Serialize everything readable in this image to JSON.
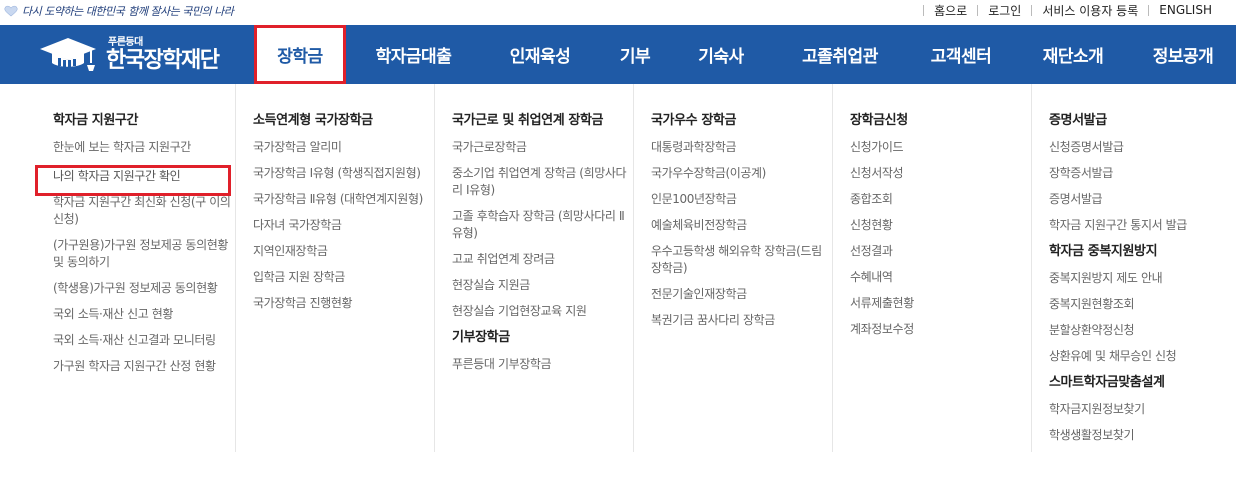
{
  "topbar": {
    "slogan_parts": [
      "다시 도약하는 대한민국",
      "함께 잘사는 국민의 나라"
    ],
    "links": [
      "홈으로",
      "로그인",
      "서비스 이용자 등록",
      "ENGLISH"
    ]
  },
  "logo": {
    "sub": "푸른등대",
    "main": "한국장학재단"
  },
  "nav": {
    "items": [
      "장학금",
      "학자금대출",
      "인재육성",
      "기부",
      "기숙사",
      "고졸취업관",
      "고객센터",
      "재단소개",
      "정보공개"
    ],
    "active": "장학금"
  },
  "colors": {
    "nav_bg": "#1f5aa6",
    "highlight_border": "#e0202a"
  },
  "dropdown": {
    "col1": {
      "title": "학자금 지원구간",
      "links": [
        "한눈에 보는 학자금 지원구간",
        "나의 학자금 지원구간 확인",
        "학자금 지원구간 최신화 신청(구 이의신청)",
        "(가구원용)가구원 정보제공 동의현황 및 동의하기",
        "(학생용)가구원 정보제공 동의현황",
        "국외 소득·재산 신고 현황",
        "국외 소득·재산 신고결과 모니터링",
        "가구원 학자금 지원구간 산정 현황"
      ]
    },
    "col2": {
      "title": "소득연계형 국가장학금",
      "links": [
        "국가장학금 알리미",
        "국가장학금 Ⅰ유형 (학생직접지원형)",
        "국가장학금 Ⅱ유형 (대학연계지원형)",
        "다자녀 국가장학금",
        "지역인재장학금",
        "입학금 지원 장학금",
        "국가장학금 진행현황"
      ]
    },
    "col3": {
      "title": "국가근로 및 취업연계 장학금",
      "links": [
        "국가근로장학금",
        "중소기업 취업연계 장학금 (희망사다리 Ⅰ유형)",
        "고졸 후학습자 장학금 (희망사다리 Ⅱ유형)",
        "고교 취업연계 장려금",
        "현장실습 지원금",
        "현장실습 기업현장교육 지원"
      ],
      "title2": "기부장학금",
      "links2": [
        "푸른등대 기부장학금"
      ]
    },
    "col4": {
      "title": "국가우수 장학금",
      "links": [
        "대통령과학장학금",
        "국가우수장학금(이공계)",
        "인문100년장학금",
        "예술체육비전장학금",
        "우수고등학생 해외유학 장학금(드림장학금)",
        "전문기술인재장학금",
        "복권기금 꿈사다리 장학금"
      ]
    },
    "col5": {
      "title": "장학금신청",
      "links": [
        "신청가이드",
        "신청서작성",
        "종합조회",
        "신청현황",
        "선정결과",
        "수혜내역",
        "서류제출현황",
        "계좌정보수정"
      ]
    },
    "col6": {
      "title": "증명서발급",
      "links": [
        "신청증명서발급",
        "장학증서발급",
        "증명서발급",
        "학자금 지원구간 통지서 발급"
      ],
      "title2": "학자금 중복지원방지",
      "links2": [
        "중복지원방지 제도 안내",
        "중복지원현황조회",
        "분할상환약정신청",
        "상환유예 및 채무승인 신청"
      ],
      "title3": "스마트학자금맞춤설계",
      "links3": [
        "학자금지원정보찾기",
        "학생생활정보찾기"
      ]
    }
  }
}
